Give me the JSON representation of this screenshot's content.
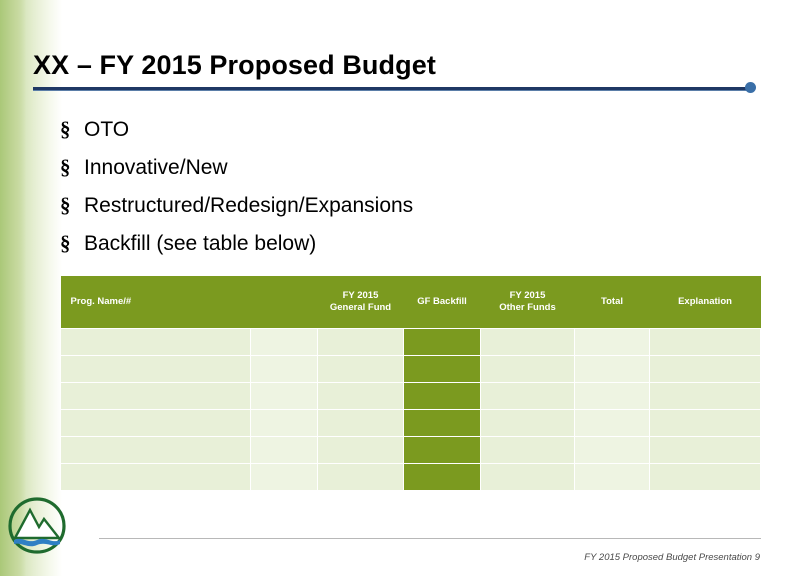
{
  "slide": {
    "title": "XX – FY 2015 Proposed Budget",
    "bullets": [
      {
        "marker": "§",
        "text": "OTO"
      },
      {
        "marker": "§",
        "text": "Innovative/New"
      },
      {
        "marker": "§",
        "text": "Restructured/Redesign/Expansions"
      },
      {
        "marker": "§",
        "text": "Backfill (see table below)"
      }
    ],
    "table": {
      "headers": [
        "Prog. Name/#",
        "",
        "FY 2015\nGeneral Fund",
        "GF Backfill",
        "FY 2015\nOther Funds",
        "Total",
        "Explanation"
      ],
      "header_lines": {
        "col0": "Prog. Name/#",
        "col1": "",
        "col2_line1": "FY 2015",
        "col2_line2": "General Fund",
        "col3": "GF Backfill",
        "col4_line1": "FY 2015",
        "col4_line2": "Other Funds",
        "col5": "Total",
        "col6": "Explanation"
      },
      "row_count": 6,
      "body_rows": [
        [
          "",
          "",
          "",
          "",
          "",
          "",
          ""
        ],
        [
          "",
          "",
          "",
          "",
          "",
          "",
          ""
        ],
        [
          "",
          "",
          "",
          "",
          "",
          "",
          ""
        ],
        [
          "",
          "",
          "",
          "",
          "",
          "",
          ""
        ],
        [
          "",
          "",
          "",
          "",
          "",
          "",
          ""
        ],
        [
          "",
          "",
          "",
          "",
          "",
          "",
          ""
        ]
      ]
    },
    "footer": "FY 2015 Proposed Budget Presentation  9",
    "colors": {
      "header_green": "#7b9a1f",
      "cell_light": "#e8f0d8",
      "rule_navy": "#1f3864",
      "dot_blue": "#3a6fa8"
    }
  }
}
